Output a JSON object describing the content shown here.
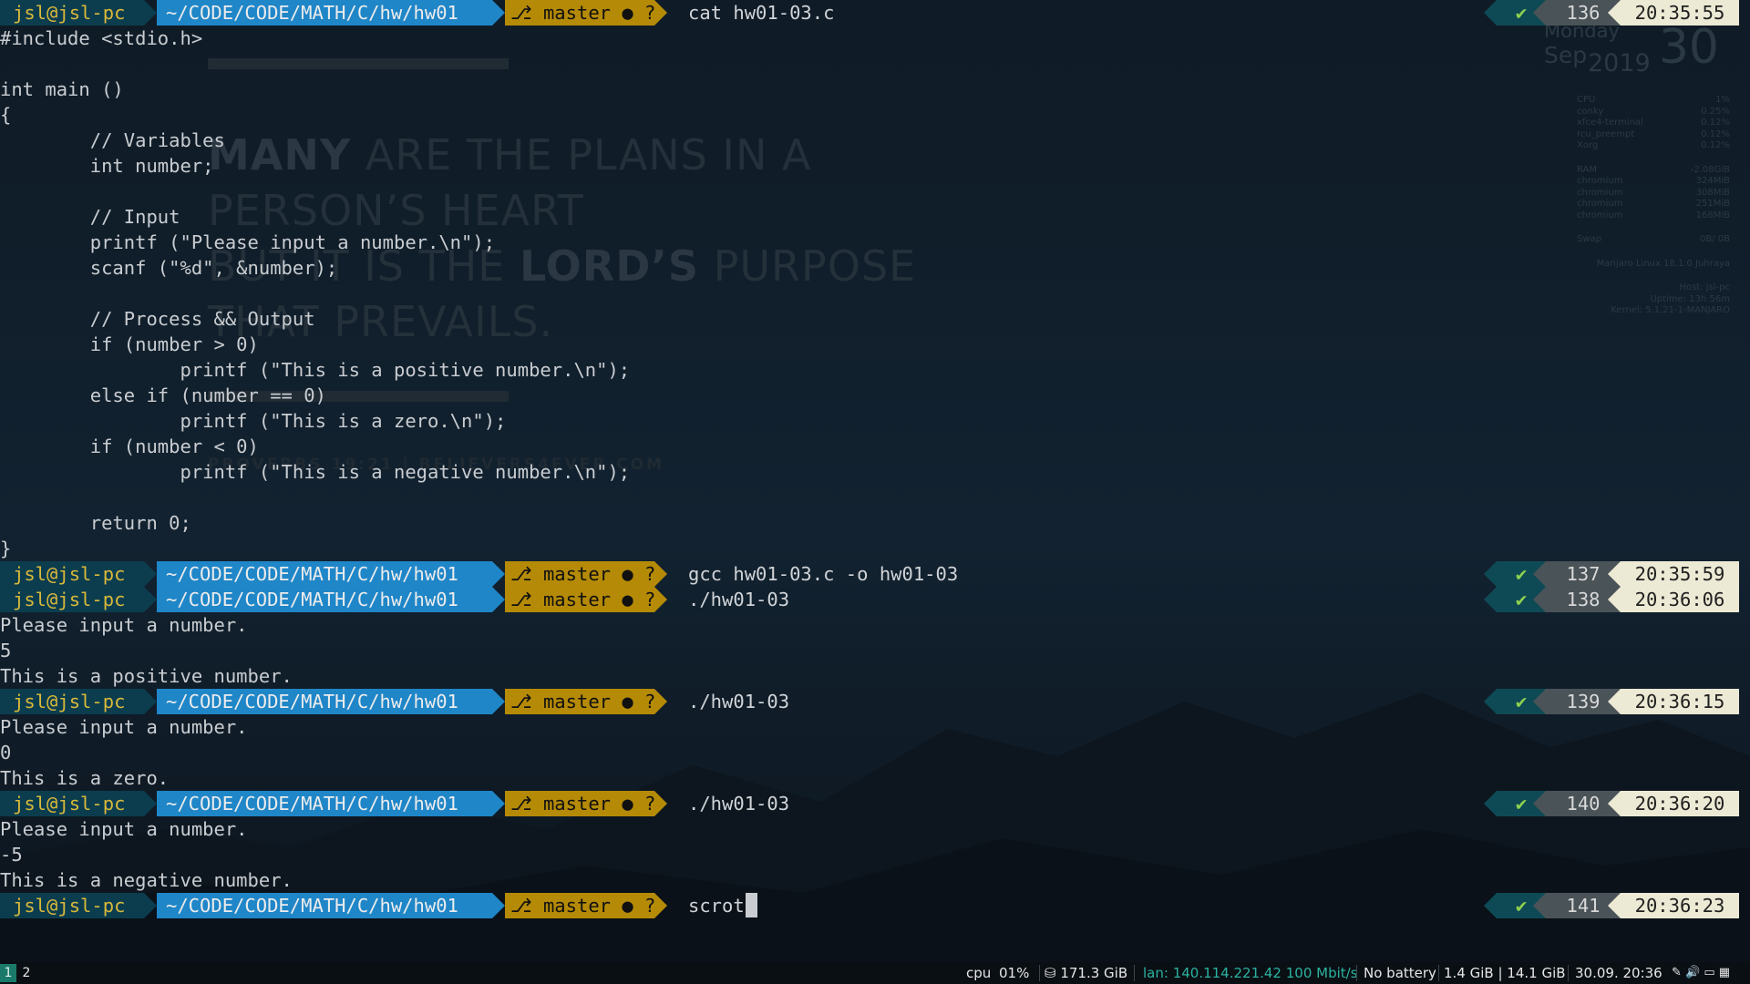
{
  "wallpaper": {
    "poster_line1_bold": "MANY",
    "poster_line1_rest": " ARE THE PLANS IN A",
    "poster_line2": "PERSON’S HEART",
    "poster_line3_pre": "BUT IT IS THE ",
    "poster_line3_bold": "LORD’S",
    "poster_line3_post": " PURPOSE",
    "poster_line4": "THAT PREVAILS.",
    "poster_credit": "PROVERBS 19:21 | BELIEVERS4EVER.COM"
  },
  "conky": {
    "day": "Monday",
    "month": "Sep",
    "year": "2019",
    "date": "30",
    "cpu_label": "CPU",
    "cpu_val": "1%",
    "procs": [
      {
        "name": "conky",
        "val": "0.25%"
      },
      {
        "name": "xfce4-terminal",
        "val": "0.12%"
      },
      {
        "name": "rcu_preempt",
        "val": "0.12%"
      },
      {
        "name": "Xorg",
        "val": "0.12%"
      }
    ],
    "ram_label": "RAM",
    "ram_val": "-2.08GiB",
    "mems": [
      {
        "name": "chromium",
        "val": "324MiB"
      },
      {
        "name": "chromium",
        "val": "308MiB"
      },
      {
        "name": "chromium",
        "val": "251MiB"
      },
      {
        "name": "chromium",
        "val": "168MiB"
      }
    ],
    "swap_label": "Swap",
    "swap_val": "0B/ 0B",
    "os": "Manjaro Linux 18.1.0 Juhraya",
    "host_label": "Host:",
    "host_val": "jsl-pc",
    "uptime_label": "Uptime:",
    "uptime_val": "13h 56m",
    "kernel_label": "Kernel:",
    "kernel_val": "5.1.21-1-MANJARO"
  },
  "prompt": {
    "user": "jsl@jsl-pc",
    "path": "~/CODE/CODE/MATH/C/hw/hw01",
    "git": "master ● ?",
    "branch_glyph": "⎇",
    "check": "✔"
  },
  "commands": [
    {
      "cmd": "cat hw01-03.c",
      "num": "136",
      "time": "20:35:55"
    },
    {
      "cmd": "gcc hw01-03.c -o hw01-03",
      "num": "137",
      "time": "20:35:59"
    },
    {
      "cmd": "./hw01-03",
      "num": "138",
      "time": "20:36:06"
    },
    {
      "cmd": "./hw01-03",
      "num": "139",
      "time": "20:36:15"
    },
    {
      "cmd": "./hw01-03",
      "num": "140",
      "time": "20:36:20"
    },
    {
      "cmd": "scrot",
      "num": "141",
      "time": "20:36:23"
    }
  ],
  "source_lines": [
    "#include <stdio.h>",
    "",
    "int main ()",
    "{",
    "        // Variables",
    "        int number;",
    "",
    "        // Input",
    "        printf (\"Please input a number.\\n\");",
    "        scanf (\"%d\", &number);",
    "",
    "        // Process && Output",
    "        if (number > 0)",
    "                printf (\"This is a positive number.\\n\");",
    "        else if (number == 0)",
    "                printf (\"This is a zero.\\n\");",
    "        if (number < 0)",
    "                printf (\"This is a negative number.\\n\");",
    "",
    "        return 0;",
    "}"
  ],
  "outputs": {
    "run1": [
      "Please input a number.",
      "5",
      "This is a positive number."
    ],
    "run2": [
      "Please input a number.",
      "0",
      "This is a zero."
    ],
    "run3": [
      "Please input a number.",
      "-5",
      "This is a negative number."
    ]
  },
  "statusbar": {
    "workspaces": [
      "1",
      "2"
    ],
    "cpu_label": "cpu",
    "cpu_val": "01%",
    "disk": "⛁ 171.3 GiB",
    "lan": "lan: 140.114.221.42 100 Mbit/s",
    "battery": "No battery",
    "mem": "1.4 GiB | 14.1 GiB",
    "datetime": "30.09. 20:36",
    "tray": "✎ 🔊 ▭ ▦"
  },
  "colors": {
    "user_bg": "#0b3d4f",
    "user_fg": "#d9b83a",
    "path_bg": "#1f86c8",
    "path_fg": "#ececec",
    "git_bg": "#b58a06",
    "git_fg": "#101010",
    "ok_bg": "#0e4a55",
    "ok_fg": "#8fd14f",
    "num_bg": "#4a5358",
    "num_fg": "#d8d8d8",
    "time_bg": "#ece9d4",
    "time_fg": "#202020",
    "lan": "#2bb3a0"
  }
}
